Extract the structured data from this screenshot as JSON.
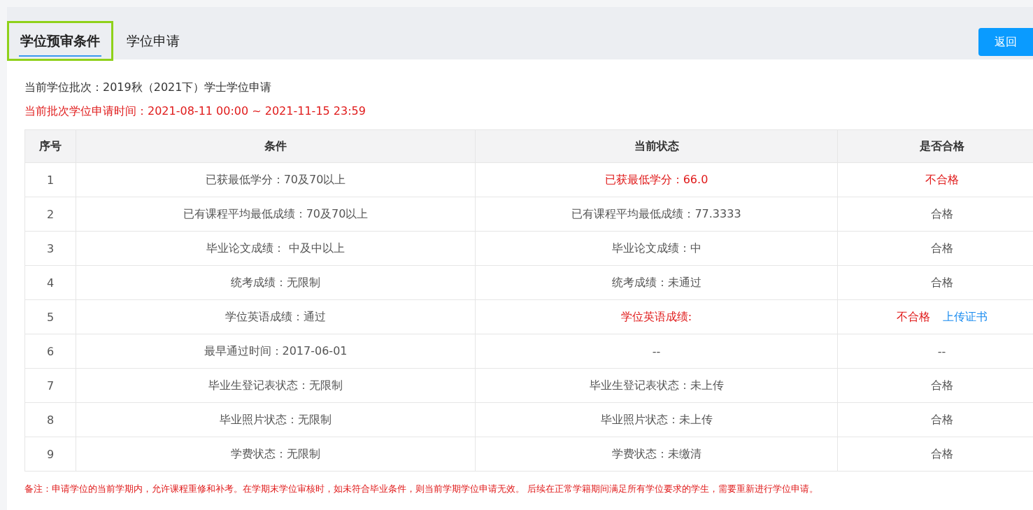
{
  "tabs": [
    {
      "label": "学位预审条件",
      "selected": true,
      "highlighted": true
    },
    {
      "label": "学位申请",
      "selected": false,
      "highlighted": false
    }
  ],
  "back_button": "返回",
  "batch": "当前学位批次：2019秋（2021下）学士学位申请",
  "period": "当前批次学位申请时间：2021-08-11 00:00 ~ 2021-11-15 23:59",
  "table": {
    "columns": [
      "序号",
      "条件",
      "当前状态",
      "是否合格"
    ],
    "rows": [
      {
        "index": "1",
        "condition": "已获最低学分：70及70以上",
        "status": "已获最低学分：66.0",
        "status_ok": false,
        "result": "不合格",
        "result_ok": false
      },
      {
        "index": "2",
        "condition": "已有课程平均最低成绩：70及70以上",
        "status": "已有课程平均最低成绩：77.3333",
        "status_ok": true,
        "result": "合格",
        "result_ok": true
      },
      {
        "index": "3",
        "condition": "毕业论文成绩： 中及中以上",
        "status": "毕业论文成绩：中",
        "status_ok": true,
        "result": "合格",
        "result_ok": true
      },
      {
        "index": "4",
        "condition": "统考成绩：无限制",
        "status": "统考成绩：未通过",
        "status_ok": true,
        "result": "合格",
        "result_ok": true
      },
      {
        "index": "5",
        "condition": "学位英语成绩：通过",
        "status": "学位英语成绩:",
        "status_ok": false,
        "result": "不合格",
        "result_ok": false,
        "action": "上传证书"
      },
      {
        "index": "6",
        "condition": "最早通过时间：2017-06-01",
        "status": "--",
        "status_ok": true,
        "result": "--",
        "result_ok": true
      },
      {
        "index": "7",
        "condition": "毕业生登记表状态：无限制",
        "status": "毕业生登记表状态：未上传",
        "status_ok": true,
        "result": "合格",
        "result_ok": true
      },
      {
        "index": "8",
        "condition": "毕业照片状态：无限制",
        "status": "毕业照片状态：未上传",
        "status_ok": true,
        "result": "合格",
        "result_ok": true
      },
      {
        "index": "9",
        "condition": "学费状态：无限制",
        "status": "学费状态：未缴清",
        "status_ok": true,
        "result": "合格",
        "result_ok": true
      }
    ]
  },
  "note": "备注：申请学位的当前学期内，允许课程重修和补考。在学期末学位审核时，如未符合毕业条件，则当前学期学位申请无效。 后续在正常学籍期间满足所有学位要求的学生，需要重新进行学位申请。"
}
